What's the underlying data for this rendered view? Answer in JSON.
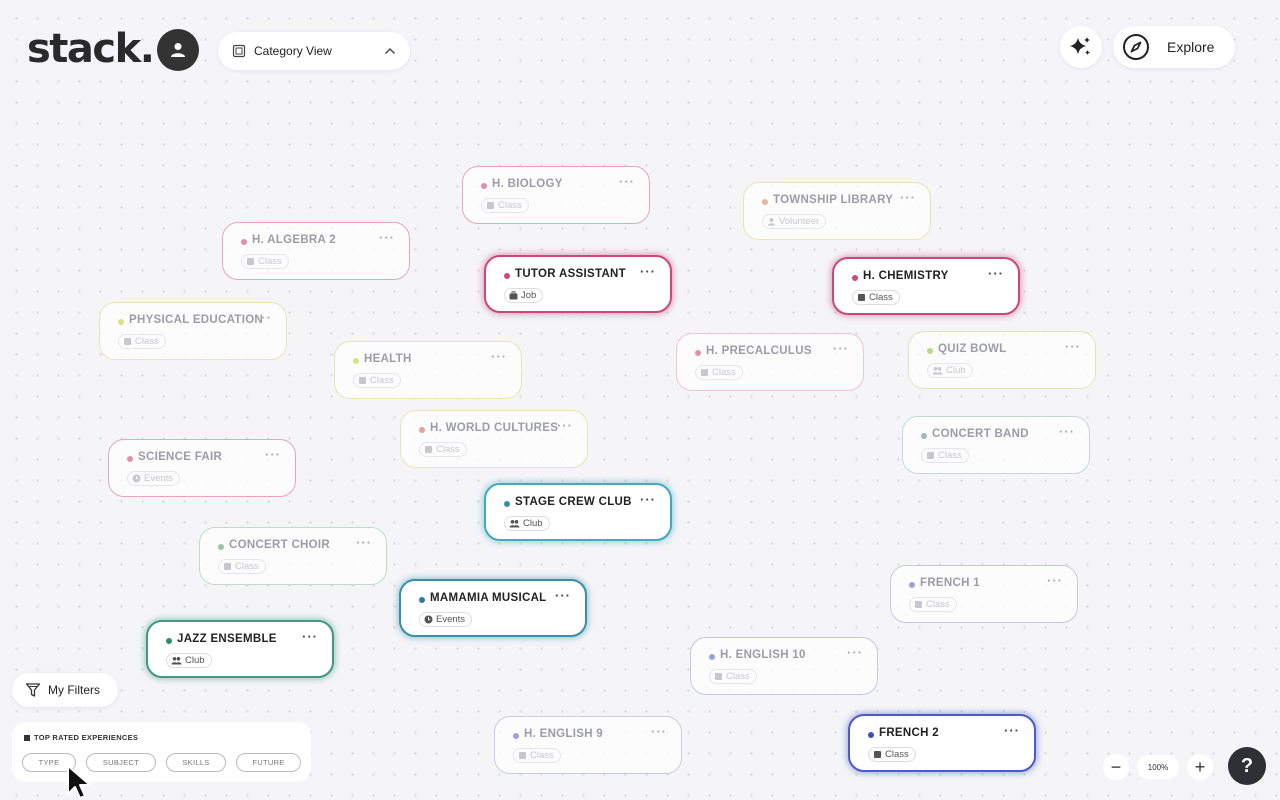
{
  "app": {
    "logo": "stack."
  },
  "header": {
    "view_selector": "Category View",
    "explore_label": "Explore"
  },
  "cards": [
    {
      "title": "H. BIOLOGY",
      "tag": "Class",
      "tag_icon": "book-icon",
      "color": "#e8a5b8",
      "dot": "#e090a8",
      "highlight": false
    },
    {
      "title": "TOWNSHIP LIBRARY",
      "tag": "Volunteer",
      "tag_icon": "person-icon",
      "color": "#e6e6b0",
      "dot": "#e8b49a",
      "highlight": false
    },
    {
      "title": "H. ALGEBRA 2",
      "tag": "Class",
      "tag_icon": "book-icon",
      "color": "#e8a5b8",
      "dot": "#e090a8",
      "highlight": false
    },
    {
      "title": "TUTOR ASSISTANT",
      "tag": "Job",
      "tag_icon": "briefcase-icon",
      "color": "#c74a78",
      "dot": "#c74a78",
      "highlight": true
    },
    {
      "title": "H. CHEMISTRY",
      "tag": "Class",
      "tag_icon": "book-icon",
      "color": "#c74a78",
      "dot": "#c74a78",
      "highlight": true
    },
    {
      "title": "PHYSICAL EDUCATION",
      "tag": "Class",
      "tag_icon": "book-icon",
      "color": "#e6e6b0",
      "dot": "#dede88",
      "highlight": false
    },
    {
      "title": "HEALTH",
      "tag": "Class",
      "tag_icon": "book-icon",
      "color": "#e6e6b0",
      "dot": "#dede88",
      "highlight": false
    },
    {
      "title": "H. PRECALCULUS",
      "tag": "Class",
      "tag_icon": "book-icon",
      "color": "#ecc6d2",
      "dot": "#e090a8",
      "highlight": false
    },
    {
      "title": "QUIZ BOWL",
      "tag": "Club",
      "tag_icon": "people-icon",
      "color": "#dde6b8",
      "dot": "#b8d88a",
      "highlight": false
    },
    {
      "title": "H. WORLD CULTURES",
      "tag": "Class",
      "tag_icon": "book-icon",
      "color": "#e6e6b0",
      "dot": "#e8a0a0",
      "highlight": false
    },
    {
      "title": "SCIENCE FAIR",
      "tag": "Events",
      "tag_icon": "clock-icon",
      "color": "#e8a5b8",
      "dot": "#e090a8",
      "highlight": false
    },
    {
      "title": "CONCERT BAND",
      "tag": "Class",
      "tag_icon": "book-icon",
      "color": "#c8d6dc",
      "dot": "#9bbcb8",
      "highlight": false
    },
    {
      "title": "STAGE CREW CLUB",
      "tag": "Club",
      "tag_icon": "people-icon",
      "color": "#45a7bd",
      "dot": "#3a8fa8",
      "highlight": true
    },
    {
      "title": "CONCERT CHOIR",
      "tag": "Class",
      "tag_icon": "book-icon",
      "color": "#c8d6c8",
      "dot": "#9bc4a8",
      "highlight": false
    },
    {
      "title": "MAMAMIA MUSICAL",
      "tag": "Events",
      "tag_icon": "clock-icon",
      "color": "#3a8fa8",
      "dot": "#2f7d95",
      "highlight": true
    },
    {
      "title": "FRENCH 1",
      "tag": "Class",
      "tag_icon": "book-icon",
      "color": "#c4c8e2",
      "dot": "#9aa4d8",
      "highlight": false
    },
    {
      "title": "JAZZ ENSEMBLE",
      "tag": "Club",
      "tag_icon": "people-icon",
      "color": "#3f9a7e",
      "dot": "#2f8a6c",
      "highlight": true
    },
    {
      "title": "H. ENGLISH 10",
      "tag": "Class",
      "tag_icon": "book-icon",
      "color": "#c4c8e2",
      "dot": "#9aa4d8",
      "highlight": false
    },
    {
      "title": "H. ENGLISH 9",
      "tag": "Class",
      "tag_icon": "book-icon",
      "color": "#c8cce4",
      "dot": "#9aa4d8",
      "highlight": false
    },
    {
      "title": "FRENCH 2",
      "tag": "Class",
      "tag_icon": "book-icon",
      "color": "#4a5cc7",
      "dot": "#3f4fb8",
      "highlight": true
    }
  ],
  "filters": {
    "label": "My Filters"
  },
  "top_rated": {
    "heading": "TOP RATED EXPERIENCES",
    "pills": [
      "TYPE",
      "SUBJECT",
      "SKILLS",
      "FUTURE"
    ]
  },
  "zoom": {
    "level": "100%",
    "minus": "−",
    "plus": "+"
  },
  "help": {
    "label": "?"
  }
}
